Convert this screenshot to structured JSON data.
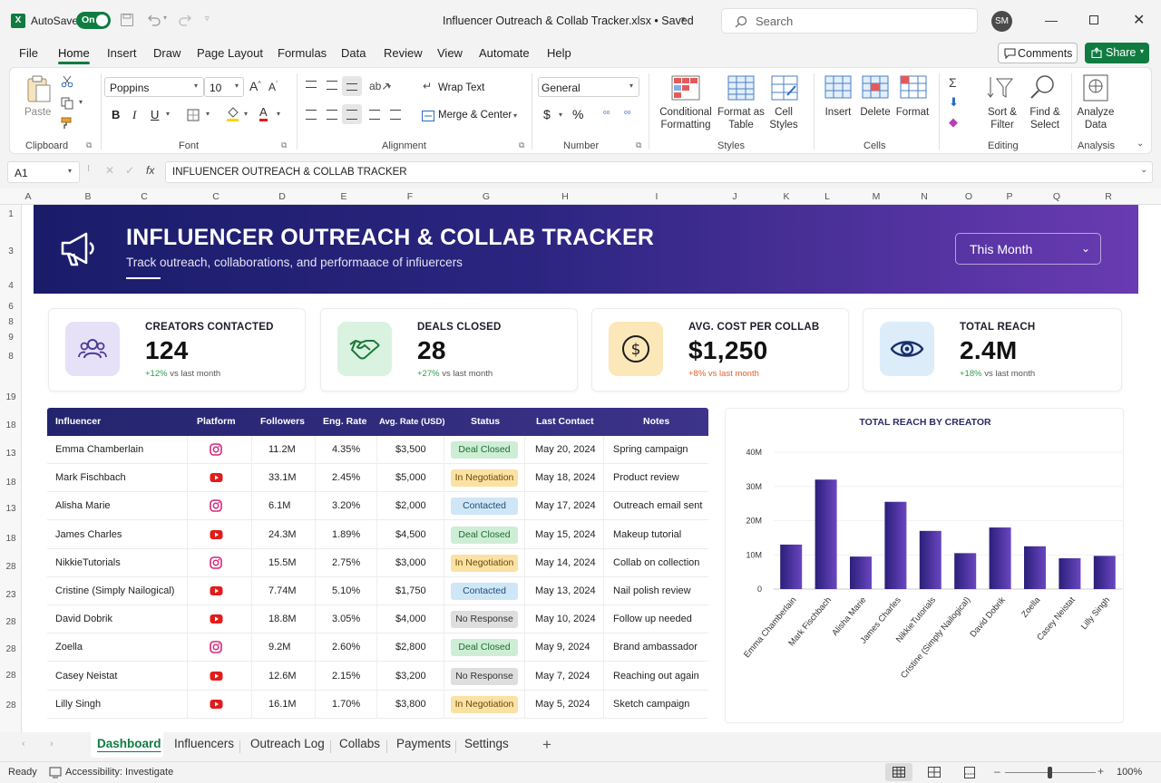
{
  "app": {
    "autosave_label": "AutoSave",
    "autosave_state": "On",
    "file_title": "Influencer Outreach & Collab Tracker.xlsx • Saved",
    "search_placeholder": "Search",
    "user_initials": "SM"
  },
  "menu": {
    "items": [
      "File",
      "Home",
      "Insert",
      "Draw",
      "Page Layout",
      "Formulas",
      "Data",
      "Review",
      "View",
      "Automate",
      "Help"
    ],
    "comments_label": "Comments",
    "share_label": "Share"
  },
  "ribbon": {
    "paste_label": "Paste",
    "font_name": "Poppins",
    "font_size": "10",
    "wrap_text_label": "Wrap Text",
    "merge_center_label": "Merge & Center",
    "number_format": "General",
    "conditional_formatting_label": "Conditional Formatting",
    "format_as_table_label": "Format as Table",
    "cell_styles_label": "Cell Styles",
    "insert_label": "Insert",
    "delete_label": "Delete",
    "format_label": "Format",
    "sort_filter_label": "Sort & Filter",
    "find_select_label": "Find & Select",
    "analyze_data_label": "Analyze Data",
    "groups": {
      "clipboard": "Clipboard",
      "font": "Font",
      "alignment": "Alignment",
      "number": "Number",
      "styles": "Styles",
      "cells": "Cells",
      "editing": "Editing",
      "analysis": "Analysis"
    }
  },
  "formula_bar": {
    "cell_ref": "A1",
    "fx": "fx",
    "content": "INFLUENCER OUTREACH & COLLAB TRACKER"
  },
  "columns": [
    "A",
    "B",
    "C",
    "C",
    "D",
    "E",
    "F",
    "G",
    "H",
    "I",
    "J",
    "K",
    "L",
    "M",
    "N",
    "O",
    "P",
    "Q",
    "R"
  ],
  "rows": [
    "1",
    "3",
    "4",
    "6",
    "8",
    "9",
    "8",
    "19",
    "18",
    "13",
    "18",
    "13",
    "18",
    "28",
    "23",
    "28",
    "28",
    "28",
    "28"
  ],
  "dashboard": {
    "title": "INFLUENCER OUTREACH & COLLAB TRACKER",
    "subtitle": "Track outreach, collaborations, and performaace of infiuercers",
    "period_select": "This Month",
    "banner_gradient_start": "#1c1d6b",
    "banner_gradient_end": "#6a3ab0"
  },
  "kpis": [
    {
      "label": "CREATORS CONTACTED",
      "value": "124",
      "delta": "+12%",
      "delta_suffix": "vs last month",
      "trend": "up",
      "icon": "users-icon",
      "bg": "#e6e1f7"
    },
    {
      "label": "DEALS CLOSED",
      "value": "28",
      "delta": "+27%",
      "delta_suffix": "vs last month",
      "trend": "up",
      "icon": "handshake-icon",
      "bg": "#d9f3e0"
    },
    {
      "label": "AVG. COST PER COLLAB",
      "value": "$1,250",
      "delta": "+8%",
      "delta_suffix": "vs last month",
      "trend": "down",
      "icon": "dollar-icon",
      "bg": "#fbe7b8"
    },
    {
      "label": "TOTAL REACH",
      "value": "2.4M",
      "delta": "+18%",
      "delta_suffix": "vs last month",
      "trend": "up",
      "icon": "eye-icon",
      "bg": "#dcecf9"
    }
  ],
  "table": {
    "headers": [
      "Influencer",
      "Platform",
      "Followers",
      "Eng. Rate",
      "Avg. Rate (USD)",
      "Status",
      "Last Contact",
      "Notes"
    ],
    "rows": [
      {
        "name": "Emma Chamberlain",
        "platform": "instagram",
        "followers": "11.2M",
        "eng": "4.35%",
        "rate": "$3,500",
        "status": "Deal Closed",
        "last": "May 20, 2024",
        "notes": "Spring campaign"
      },
      {
        "name": "Mark Fischbach",
        "platform": "youtube",
        "followers": "33.1M",
        "eng": "2.45%",
        "rate": "$5,000",
        "status": "In Negotiation",
        "last": "May 18, 2024",
        "notes": "Product review"
      },
      {
        "name": "Alisha Marie",
        "platform": "instagram",
        "followers": "6.1M",
        "eng": "3.20%",
        "rate": "$2,000",
        "status": "Contacted",
        "last": "May 17, 2024",
        "notes": "Outreach email sent"
      },
      {
        "name": "James Charles",
        "platform": "youtube",
        "followers": "24.3M",
        "eng": "1.89%",
        "rate": "$4,500",
        "status": "Deal Closed",
        "last": "May 15, 2024",
        "notes": "Makeup tutorial"
      },
      {
        "name": "NikkieTutorials",
        "platform": "instagram",
        "followers": "15.5M",
        "eng": "2.75%",
        "rate": "$3,000",
        "status": "In Negotiation",
        "last": "May 14, 2024",
        "notes": "Collab on collection"
      },
      {
        "name": "Cristine (Simply Nailogical)",
        "platform": "youtube",
        "followers": "7.74M",
        "eng": "5.10%",
        "rate": "$1,750",
        "status": "Contacted",
        "last": "May 13, 2024",
        "notes": "Nail polish review"
      },
      {
        "name": "David Dobrik",
        "platform": "youtube",
        "followers": "18.8M",
        "eng": "3.05%",
        "rate": "$4,000",
        "status": "No Response",
        "last": "May 10, 2024",
        "notes": "Follow up needed"
      },
      {
        "name": "Zoella",
        "platform": "instagram",
        "followers": "9.2M",
        "eng": "2.60%",
        "rate": "$2,800",
        "status": "Deal Closed",
        "last": "May 9, 2024",
        "notes": "Brand ambassador"
      },
      {
        "name": "Casey Neistat",
        "platform": "youtube",
        "followers": "12.6M",
        "eng": "2.15%",
        "rate": "$3,200",
        "status": "No Response",
        "last": "May 7, 2024",
        "notes": "Reaching out again"
      },
      {
        "name": "Lilly Singh",
        "platform": "youtube",
        "followers": "16.1M",
        "eng": "1.70%",
        "rate": "$3,800",
        "status": "In Negotiation",
        "last": "May 5, 2024",
        "notes": "Sketch campaign"
      }
    ],
    "status_colors": {
      "Deal Closed": {
        "bg": "#cdeed5",
        "fg": "#1e6b34"
      },
      "In Negotiation": {
        "bg": "#fbe1a3",
        "fg": "#6b4a08"
      },
      "Contacted": {
        "bg": "#cfe6f7",
        "fg": "#1d4d75"
      },
      "No Response": {
        "bg": "#dedede",
        "fg": "#333333"
      }
    }
  },
  "chart_data": {
    "type": "bar",
    "title": "TOTAL REACH BY CREATOR",
    "categories": [
      "Emma Chamberlain",
      "Mark Fischbach",
      "Alisha Marie",
      "James Charles",
      "NikkieTutorials",
      "Cristine (Simply Nailogical)",
      "David Dobrik",
      "Zoella",
      "Casey Neistat",
      "Lilly Singh"
    ],
    "values": [
      13,
      32,
      9.5,
      25.5,
      17,
      10.5,
      18,
      12.5,
      9,
      9.7
    ],
    "unit": "M",
    "ylim": [
      0,
      40
    ],
    "yticks": [
      "0",
      "10M",
      "20M",
      "30M",
      "40M"
    ],
    "bar_color": "#4a2f9a"
  },
  "sheet_tabs": [
    "Dashboard",
    "Influencers",
    "Outreach Log",
    "Collabs",
    "Payments",
    "Settings"
  ],
  "status_bar": {
    "ready": "Ready",
    "accessibility": "Accessibility: Investigate",
    "zoom": "100%"
  }
}
